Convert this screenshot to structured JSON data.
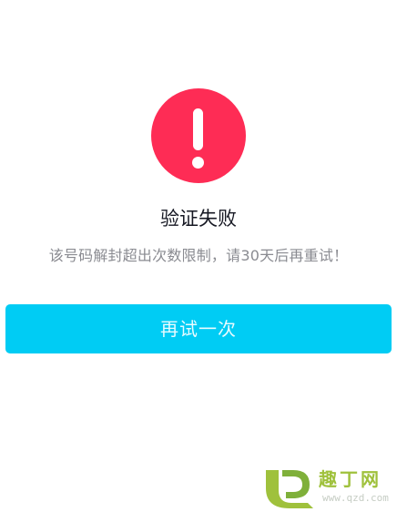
{
  "dialog": {
    "icon": "exclamation-icon",
    "title": "验证失败",
    "message": "该号码解封超出次数限制，请30天后再重试！",
    "retry_label": "再试一次"
  },
  "watermark": {
    "brand": "趣丁网",
    "url": "www.qzd.com"
  },
  "colors": {
    "alert": "#fe2c55",
    "button": "#00ccf4",
    "title": "#161823",
    "message": "#8a8b91"
  }
}
